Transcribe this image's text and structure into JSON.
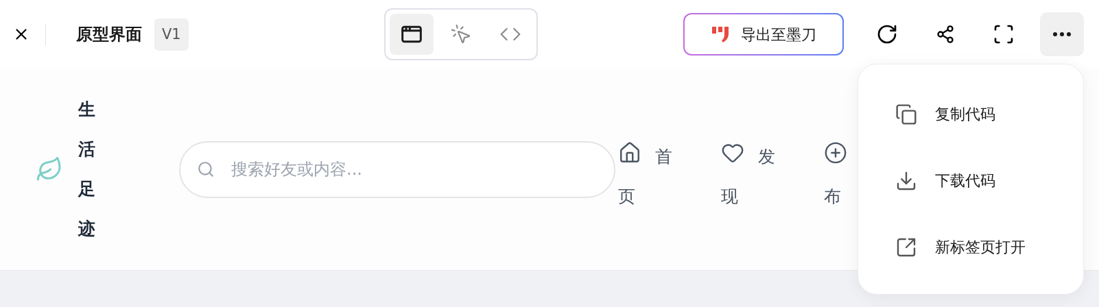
{
  "toolbar": {
    "title": "原型界面",
    "version": "V1",
    "view_modes": [
      {
        "kind": "preview",
        "selected": true
      },
      {
        "kind": "select",
        "selected": false
      },
      {
        "kind": "code",
        "selected": false
      }
    ],
    "export_button": "导出至墨刀"
  },
  "prototype": {
    "brand": "生活足迹",
    "search": {
      "placeholder": "搜索好友或内容..."
    },
    "nav": [
      {
        "kind": "home",
        "label": "首页",
        "covered": false
      },
      {
        "kind": "heart",
        "label": "发现",
        "covered": false
      },
      {
        "kind": "plus",
        "label": "布",
        "covered": true
      }
    ]
  },
  "menu": {
    "items": [
      {
        "kind": "copy",
        "label": "复制代码"
      },
      {
        "kind": "download",
        "label": "下载代码"
      },
      {
        "kind": "open",
        "label": "新标签页打开"
      }
    ]
  }
}
